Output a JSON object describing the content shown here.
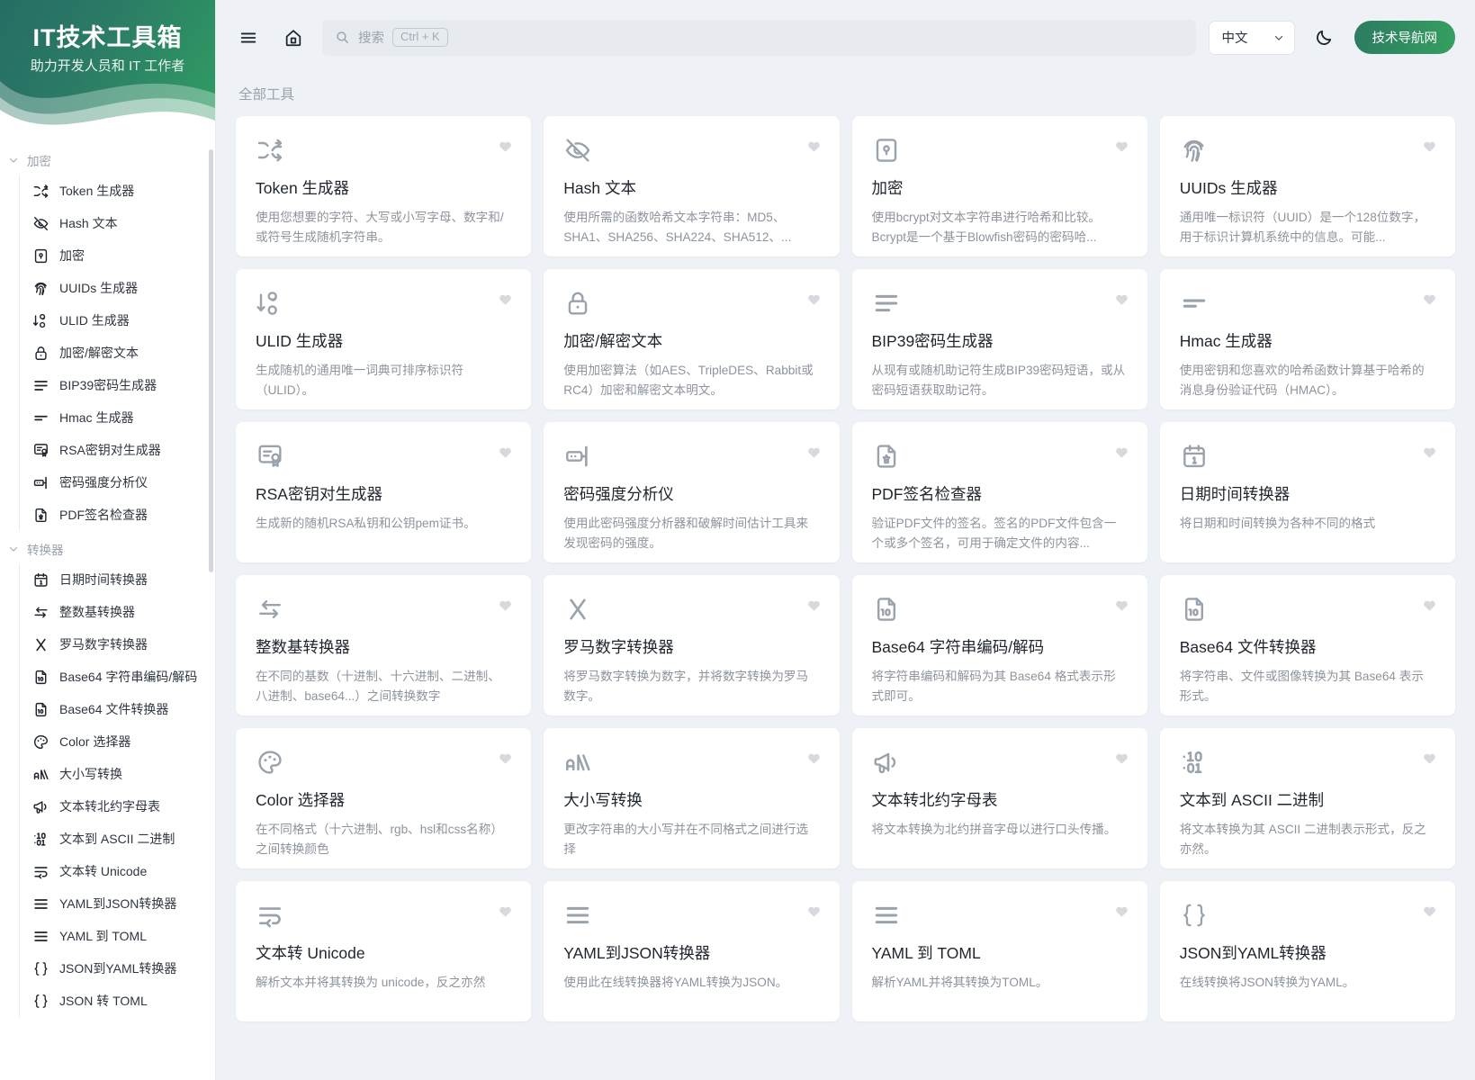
{
  "brand": {
    "title": "IT技术工具箱",
    "subtitle": "助力开发人员和 IT 工作者"
  },
  "colors": {
    "brand_green_dark": "#256d63",
    "brand_green_light": "#35a05f",
    "page_bg": "#eef1f5",
    "card_bg": "#ffffff",
    "favorite_icon": "#d6d9dd",
    "muted_text": "#8d949d"
  },
  "topbar": {
    "menu_icon": "hamburger-menu-icon",
    "home_icon": "home-icon",
    "search": {
      "icon": "search-icon",
      "placeholder": "搜索",
      "shortcut": "Ctrl + K"
    },
    "language": {
      "value": "中文",
      "chevron_icon": "chevron-down-icon"
    },
    "theme_toggle_icon": "moon-icon",
    "cta_label": "技术导航网"
  },
  "sidebar": {
    "scrollbar": true,
    "groups": [
      {
        "label": "加密",
        "expanded": true,
        "chevron_icon": "chevron-down-icon",
        "items": [
          {
            "label": "Token 生成器",
            "icon": "shuffle-icon"
          },
          {
            "label": "Hash 文本",
            "icon": "eye-off-icon"
          },
          {
            "label": "加密",
            "icon": "lock-square-icon"
          },
          {
            "label": "UUIDs 生成器",
            "icon": "fingerprint-icon"
          },
          {
            "label": "ULID 生成器",
            "icon": "sort-descending-numbers-icon"
          },
          {
            "label": "加密/解密文本",
            "icon": "padlock-icon"
          },
          {
            "label": "BIP39密码生成器",
            "icon": "align-left-lines-icon"
          },
          {
            "label": "Hmac 生成器",
            "icon": "two-lines-icon"
          },
          {
            "label": "RSA密钥对生成器",
            "icon": "certificate-icon"
          },
          {
            "label": "密码强度分析仪",
            "icon": "password-meter-icon"
          },
          {
            "label": "PDF签名检查器",
            "icon": "file-signature-icon"
          }
        ]
      },
      {
        "label": "转换器",
        "expanded": true,
        "chevron_icon": "chevron-down-icon",
        "items": [
          {
            "label": "日期时间转换器",
            "icon": "calendar-icon"
          },
          {
            "label": "整数基转换器",
            "icon": "arrows-exchange-icon"
          },
          {
            "label": "罗马数字转换器",
            "icon": "letter-x-icon"
          },
          {
            "label": "Base64 字符串编码/解码",
            "icon": "file-binary-icon"
          },
          {
            "label": "Base64 文件转换器",
            "icon": "file-binary-icon"
          },
          {
            "label": "Color 选择器",
            "icon": "palette-icon"
          },
          {
            "label": "大小写转换",
            "icon": "letter-case-icon"
          },
          {
            "label": "文本转北约字母表",
            "icon": "megaphone-icon"
          },
          {
            "label": "文本到 ASCII 二进制",
            "icon": "binary-digits-icon"
          },
          {
            "label": "文本转 Unicode",
            "icon": "text-wrap-icon"
          },
          {
            "label": "YAML到JSON转换器",
            "icon": "align-lines-icon"
          },
          {
            "label": "YAML 到 TOML",
            "icon": "align-lines-icon"
          },
          {
            "label": "JSON到YAML转换器",
            "icon": "braces-icon"
          },
          {
            "label": "JSON 转 TOML",
            "icon": "braces-icon"
          }
        ]
      }
    ]
  },
  "main": {
    "section_title": "全部工具",
    "cards": [
      {
        "title": "Token 生成器",
        "desc": "使用您想要的字符、大写或小写字母、数字和/或符号生成随机字符串。",
        "icon": "shuffle-icon",
        "fav_icon": "heart-icon"
      },
      {
        "title": "Hash 文本",
        "desc": "使用所需的函数哈希文本字符串：MD5、SHA1、SHA256、SHA224、SHA512、...",
        "icon": "eye-off-icon",
        "fav_icon": "heart-icon"
      },
      {
        "title": "加密",
        "desc": "使用bcrypt对文本字符串进行哈希和比较。Bcrypt是一个基于Blowfish密码的密码哈...",
        "icon": "lock-square-icon",
        "fav_icon": "heart-icon"
      },
      {
        "title": "UUIDs 生成器",
        "desc": "通用唯一标识符（UUID）是一个128位数字，用于标识计算机系统中的信息。可能...",
        "icon": "fingerprint-icon",
        "fav_icon": "heart-icon"
      },
      {
        "title": "ULID 生成器",
        "desc": "生成随机的通用唯一词典可排序标识符（ULID）。",
        "icon": "sort-descending-numbers-icon",
        "fav_icon": "heart-icon"
      },
      {
        "title": "加密/解密文本",
        "desc": "使用加密算法（如AES、TripleDES、Rabbit或RC4）加密和解密文本明文。",
        "icon": "padlock-icon",
        "fav_icon": "heart-icon"
      },
      {
        "title": "BIP39密码生成器",
        "desc": "从现有或随机助记符生成BIP39密码短语，或从密码短语获取助记符。",
        "icon": "align-left-lines-icon",
        "fav_icon": "heart-icon"
      },
      {
        "title": "Hmac 生成器",
        "desc": "使用密钥和您喜欢的哈希函数计算基于哈希的消息身份验证代码（HMAC）。",
        "icon": "two-lines-icon",
        "fav_icon": "heart-icon"
      },
      {
        "title": "RSA密钥对生成器",
        "desc": "生成新的随机RSA私钥和公钥pem证书。",
        "icon": "certificate-icon",
        "fav_icon": "heart-icon"
      },
      {
        "title": "密码强度分析仪",
        "desc": "使用此密码强度分析器和破解时间估计工具来发现密码的强度。",
        "icon": "password-meter-icon",
        "fav_icon": "heart-icon"
      },
      {
        "title": "PDF签名检查器",
        "desc": "验证PDF文件的签名。签名的PDF文件包含一个或多个签名，可用于确定文件的内容...",
        "icon": "file-signature-icon",
        "fav_icon": "heart-icon"
      },
      {
        "title": "日期时间转换器",
        "desc": "将日期和时间转换为各种不同的格式",
        "icon": "calendar-icon",
        "fav_icon": "heart-icon"
      },
      {
        "title": "整数基转换器",
        "desc": "在不同的基数（十进制、十六进制、二进制、八进制、base64...）之间转换数字",
        "icon": "arrows-exchange-icon",
        "fav_icon": "heart-icon"
      },
      {
        "title": "罗马数字转换器",
        "desc": "将罗马数字转换为数字，并将数字转换为罗马数字。",
        "icon": "letter-x-icon",
        "fav_icon": "heart-icon"
      },
      {
        "title": "Base64 字符串编码/解码",
        "desc": "将字符串编码和解码为其 Base64 格式表示形式即可。",
        "icon": "file-binary-icon",
        "fav_icon": "heart-icon"
      },
      {
        "title": "Base64 文件转换器",
        "desc": "将字符串、文件或图像转换为其 Base64 表示形式。",
        "icon": "file-binary-icon",
        "fav_icon": "heart-icon"
      },
      {
        "title": "Color 选择器",
        "desc": "在不同格式（十六进制、rgb、hsl和css名称）之间转换颜色",
        "icon": "palette-icon",
        "fav_icon": "heart-icon"
      },
      {
        "title": "大小写转换",
        "desc": "更改字符串的大小写并在不同格式之间进行选择",
        "icon": "letter-case-icon",
        "fav_icon": "heart-icon"
      },
      {
        "title": "文本转北约字母表",
        "desc": "将文本转换为北约拼音字母以进行口头传播。",
        "icon": "megaphone-icon",
        "fav_icon": "heart-icon"
      },
      {
        "title": "文本到 ASCII 二进制",
        "desc": "将文本转换为其 ASCII 二进制表示形式，反之亦然。",
        "icon": "binary-digits-icon",
        "fav_icon": "heart-icon"
      },
      {
        "title": "文本转 Unicode",
        "desc": "解析文本并将其转换为 unicode，反之亦然",
        "icon": "text-wrap-icon",
        "fav_icon": "heart-icon"
      },
      {
        "title": "YAML到JSON转换器",
        "desc": "使用此在线转换器将YAML转换为JSON。",
        "icon": "align-lines-icon",
        "fav_icon": "heart-icon"
      },
      {
        "title": "YAML 到 TOML",
        "desc": "解析YAML并将其转换为TOML。",
        "icon": "align-lines-icon",
        "fav_icon": "heart-icon"
      },
      {
        "title": "JSON到YAML转换器",
        "desc": "在线转换将JSON转换为YAML。",
        "icon": "braces-icon",
        "fav_icon": "heart-icon"
      }
    ]
  }
}
